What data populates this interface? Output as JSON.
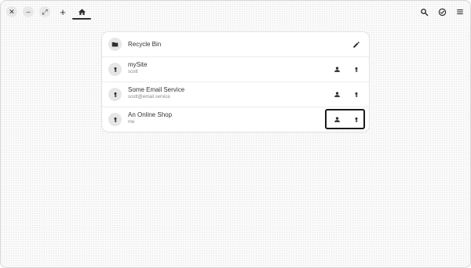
{
  "window": {
    "controls": [
      {
        "name": "close-button",
        "glyph": "✕"
      },
      {
        "name": "minimize-button",
        "glyph": "–"
      },
      {
        "name": "maximize-button",
        "glyph": "⤢"
      }
    ],
    "new_tab_glyph": "+",
    "home_icon": "home-icon",
    "header_right_icons": [
      "search-icon",
      "check-circle-icon",
      "menu-icon"
    ]
  },
  "entries": [
    {
      "title": "Recycle Bin",
      "subtitle": "",
      "icon": "folder-icon",
      "actions": [
        "edit-icon"
      ]
    },
    {
      "title": "mySite",
      "subtitle": "scott",
      "icon": "key-icon",
      "actions": [
        "user-icon",
        "key-icon"
      ]
    },
    {
      "title": "Some Email Service",
      "subtitle": "scott@email.service",
      "icon": "key-icon",
      "actions": [
        "user-icon",
        "key-icon"
      ]
    },
    {
      "title": "An Online Shop",
      "subtitle": "me",
      "icon": "key-icon",
      "actions": [
        "user-icon",
        "key-icon"
      ],
      "focused": true
    }
  ],
  "colors": {
    "accent": "#2e2e2e",
    "row_bg": "#ffffff",
    "avatar_bg": "#e6e6e6",
    "focus_ring": "#1a1a1a"
  }
}
